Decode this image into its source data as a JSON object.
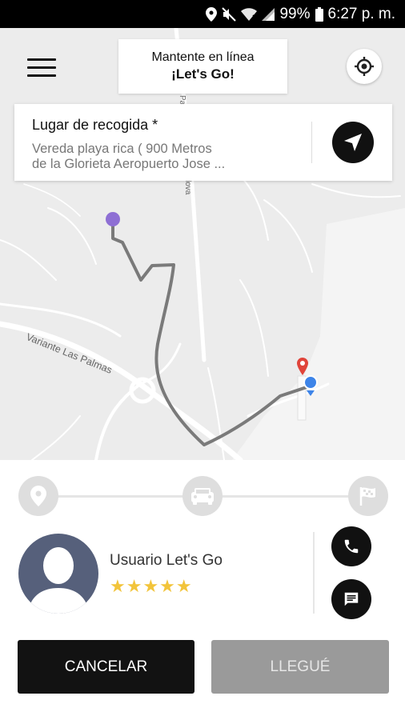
{
  "status_bar": {
    "battery": "99%",
    "time": "6:27 p. m.",
    "icons": [
      "location-icon",
      "mute-icon",
      "wifi-icon",
      "signal-icon",
      "battery-icon"
    ]
  },
  "map": {
    "streets": [
      "Variante Las Palmas",
      "Pa",
      "lova"
    ],
    "status_card": {
      "line1": "Mantente en línea",
      "line2": "¡Let's Go!"
    }
  },
  "pickup": {
    "title": "Lugar de recogida *",
    "address_line1": "Vereda playa rica ( 900 Metros",
    "address_line2": "de la Glorieta Aeropuerto Jose ..."
  },
  "progress": {
    "steps": [
      "pickup-pin-icon",
      "car-icon",
      "finish-flag-icon"
    ]
  },
  "passenger": {
    "name": "Usuario Let's Go",
    "stars": "★★★★★"
  },
  "actions": {
    "cancel_label": "CANCELAR",
    "arrived_label": "LLEGUÉ"
  },
  "colors": {
    "accent_dark": "#111111",
    "star": "#f2c43b",
    "avatar_bg": "#56607b",
    "route": "#7a7a7a",
    "origin_pin": "#8e6fd4",
    "current_location": "#3d84e8",
    "destination_pin": "#e0443a"
  }
}
